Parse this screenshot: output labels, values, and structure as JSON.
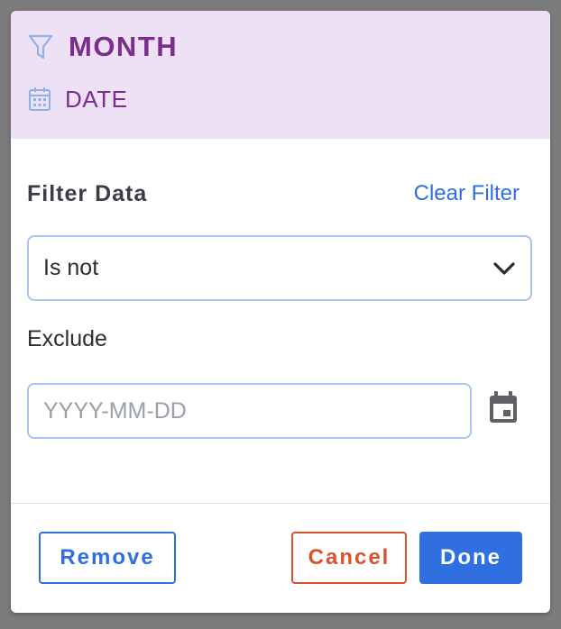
{
  "header": {
    "title": "MONTH",
    "subtitle": "DATE",
    "title_icon": "filter-icon",
    "subtitle_icon": "calendar-icon"
  },
  "filter": {
    "section_label": "Filter Data",
    "clear_label": "Clear Filter",
    "operator_selected": "Is not",
    "value_label": "Exclude",
    "date_placeholder": "YYYY-MM-DD",
    "date_value": ""
  },
  "actions": {
    "remove_label": "Remove",
    "cancel_label": "Cancel",
    "done_label": "Done"
  },
  "colors": {
    "header_bg": "#efe1f5",
    "title_color": "#7b2d8e",
    "primary": "#2f6fe0",
    "danger": "#d9532c",
    "input_border": "#a9c4f0"
  }
}
